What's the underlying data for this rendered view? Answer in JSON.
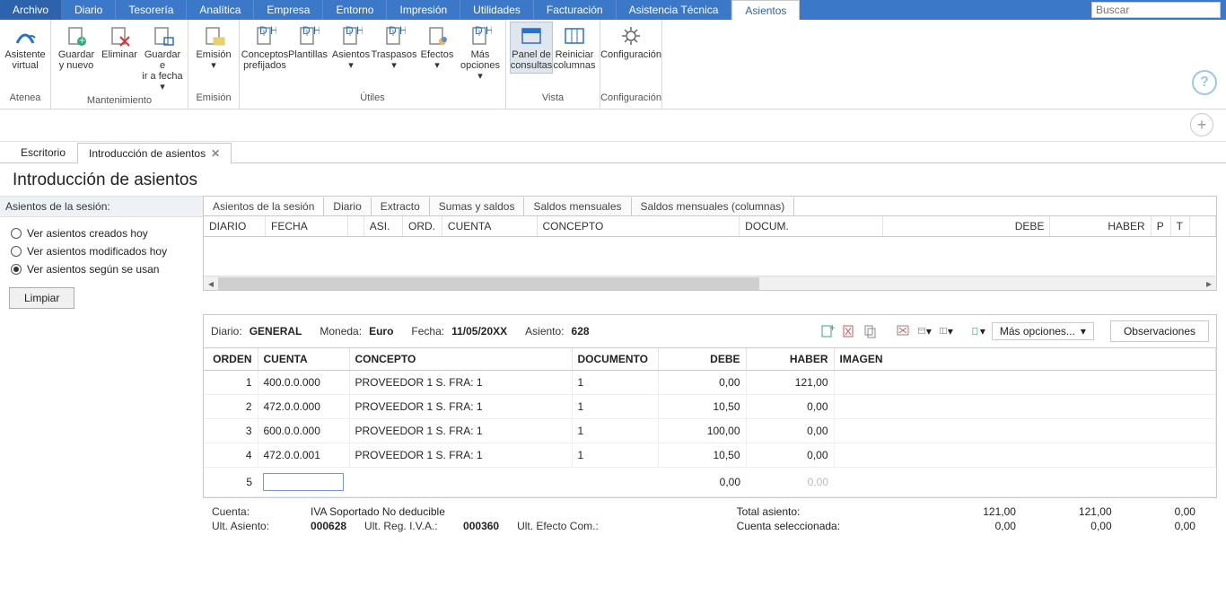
{
  "menu": [
    "Archivo",
    "Diario",
    "Tesorería",
    "Analítica",
    "Empresa",
    "Entorno",
    "Impresión",
    "Utilidades",
    "Facturación",
    "Asistencia Técnica",
    "Asientos"
  ],
  "menu_active_idx": 10,
  "search_placeholder": "Buscar",
  "ribbon": {
    "g0": {
      "cap": "Atenea",
      "btns": [
        {
          "lbl": "Asistente\nvirtual",
          "name": "atenea-icon"
        }
      ]
    },
    "g1": {
      "cap": "Mantenimiento",
      "btns": [
        {
          "lbl": "Guardar\ny nuevo",
          "name": "new-icon"
        },
        {
          "lbl": "Eliminar",
          "name": "delete-icon"
        },
        {
          "lbl": "Guardar e\nir a fecha ▾",
          "name": "save-icon"
        }
      ]
    },
    "g2": {
      "cap": "Emisión",
      "btns": [
        {
          "lbl": "Emisión\n▾",
          "name": "print-icon"
        }
      ]
    },
    "g3": {
      "cap": "Útiles",
      "btns": [
        {
          "lbl": "Conceptos\nprefijados",
          "name": "concepts-icon"
        },
        {
          "lbl": "Plantillas",
          "name": "templates-icon"
        },
        {
          "lbl": "Asientos\n▾",
          "name": "entries-icon"
        },
        {
          "lbl": "Traspasos\n▾",
          "name": "transfers-icon"
        },
        {
          "lbl": "Efectos\n▾",
          "name": "effects-icon"
        },
        {
          "lbl": "Más\nopciones ▾",
          "name": "more-options-icon"
        }
      ]
    },
    "g4": {
      "cap": "Vista",
      "btns": [
        {
          "lbl": "Panel de\nconsultas",
          "name": "panel-icon",
          "active": true
        },
        {
          "lbl": "Reiniciar\ncolumnas",
          "name": "reset-columns-icon"
        }
      ]
    },
    "g5": {
      "cap": "Configuración",
      "btns": [
        {
          "lbl": "Configuración",
          "name": "config-icon"
        }
      ]
    }
  },
  "doctabs": [
    "Escritorio",
    "Introducción de asientos"
  ],
  "doctabs_active_idx": 1,
  "page_title": "Introducción de asientos",
  "side": {
    "header": "Asientos de la sesión:",
    "r0": "Ver asientos creados hoy",
    "r1": "Ver asientos modificados hoy",
    "r2": "Ver asientos según se usan",
    "selected": 2,
    "clear": "Limpiar"
  },
  "inner_tabs": [
    "Asientos de la sesión",
    "Diario",
    "Extracto",
    "Sumas y saldos",
    "Saldos mensuales",
    "Saldos mensuales (columnas)"
  ],
  "inner_active_idx": 0,
  "session_cols": [
    "DIARIO",
    "FECHA",
    "",
    "ASI.",
    "ORD.",
    "CUENTA",
    "CONCEPTO",
    "DOCUM.",
    "DEBE",
    "HABER",
    "P",
    "T",
    ""
  ],
  "entryhdr": {
    "diario_k": "Diario:",
    "diario_v": "GENERAL",
    "moneda_k": "Moneda:",
    "moneda_v": "Euro",
    "fecha_k": "Fecha:",
    "fecha_v": "11/05/20XX",
    "asiento_k": "Asiento:",
    "asiento_v": "628",
    "more": "Más opciones...",
    "obs": "Observaciones"
  },
  "entry_cols": [
    "ORDEN",
    "CUENTA",
    "CONCEPTO",
    "DOCUMENTO",
    "DEBE",
    "HABER",
    "IMAGEN"
  ],
  "entry_al": [
    "right",
    "left",
    "left",
    "left",
    "right",
    "right",
    "left"
  ],
  "entry_w": [
    "60",
    "98",
    "248",
    "96",
    "98",
    "98",
    ""
  ],
  "rows": [
    {
      "orden": "1",
      "cuenta": "400.0.0.000",
      "concepto": "PROVEEDOR 1 S. FRA:  1",
      "doc": "1",
      "debe": "0,00",
      "haber": "121,00"
    },
    {
      "orden": "2",
      "cuenta": "472.0.0.000",
      "concepto": "PROVEEDOR 1 S. FRA:  1",
      "doc": "1",
      "debe": "10,50",
      "haber": "0,00"
    },
    {
      "orden": "3",
      "cuenta": "600.0.0.000",
      "concepto": "PROVEEDOR 1 S. FRA:  1",
      "doc": "1",
      "debe": "100,00",
      "haber": "0,00"
    },
    {
      "orden": "4",
      "cuenta": "472.0.0.001",
      "concepto": "PROVEEDOR 1 S. FRA:  1",
      "doc": "1",
      "debe": "10,50",
      "haber": "0,00"
    }
  ],
  "inputrow": {
    "orden": "5",
    "debe": "0,00",
    "haber": "0,00"
  },
  "footer": {
    "cuenta_k": "Cuenta:",
    "cuenta_v": "IVA Soportado No deducible",
    "ult_asiento_k": "Ult. Asiento:",
    "ult_asiento_v": "000628",
    "ult_reg_k": "Ult. Reg. I.V.A.:",
    "ult_reg_v": "000360",
    "ult_efecto_k": "Ult. Efecto Com.:",
    "ult_efecto_v": "",
    "total_k": "Total asiento:",
    "sel_k": "Cuenta seleccionada:",
    "c1a": "121,00",
    "c1b": "0,00",
    "c2a": "121,00",
    "c2b": "0,00",
    "c3a": "0,00",
    "c3b": "0,00"
  }
}
